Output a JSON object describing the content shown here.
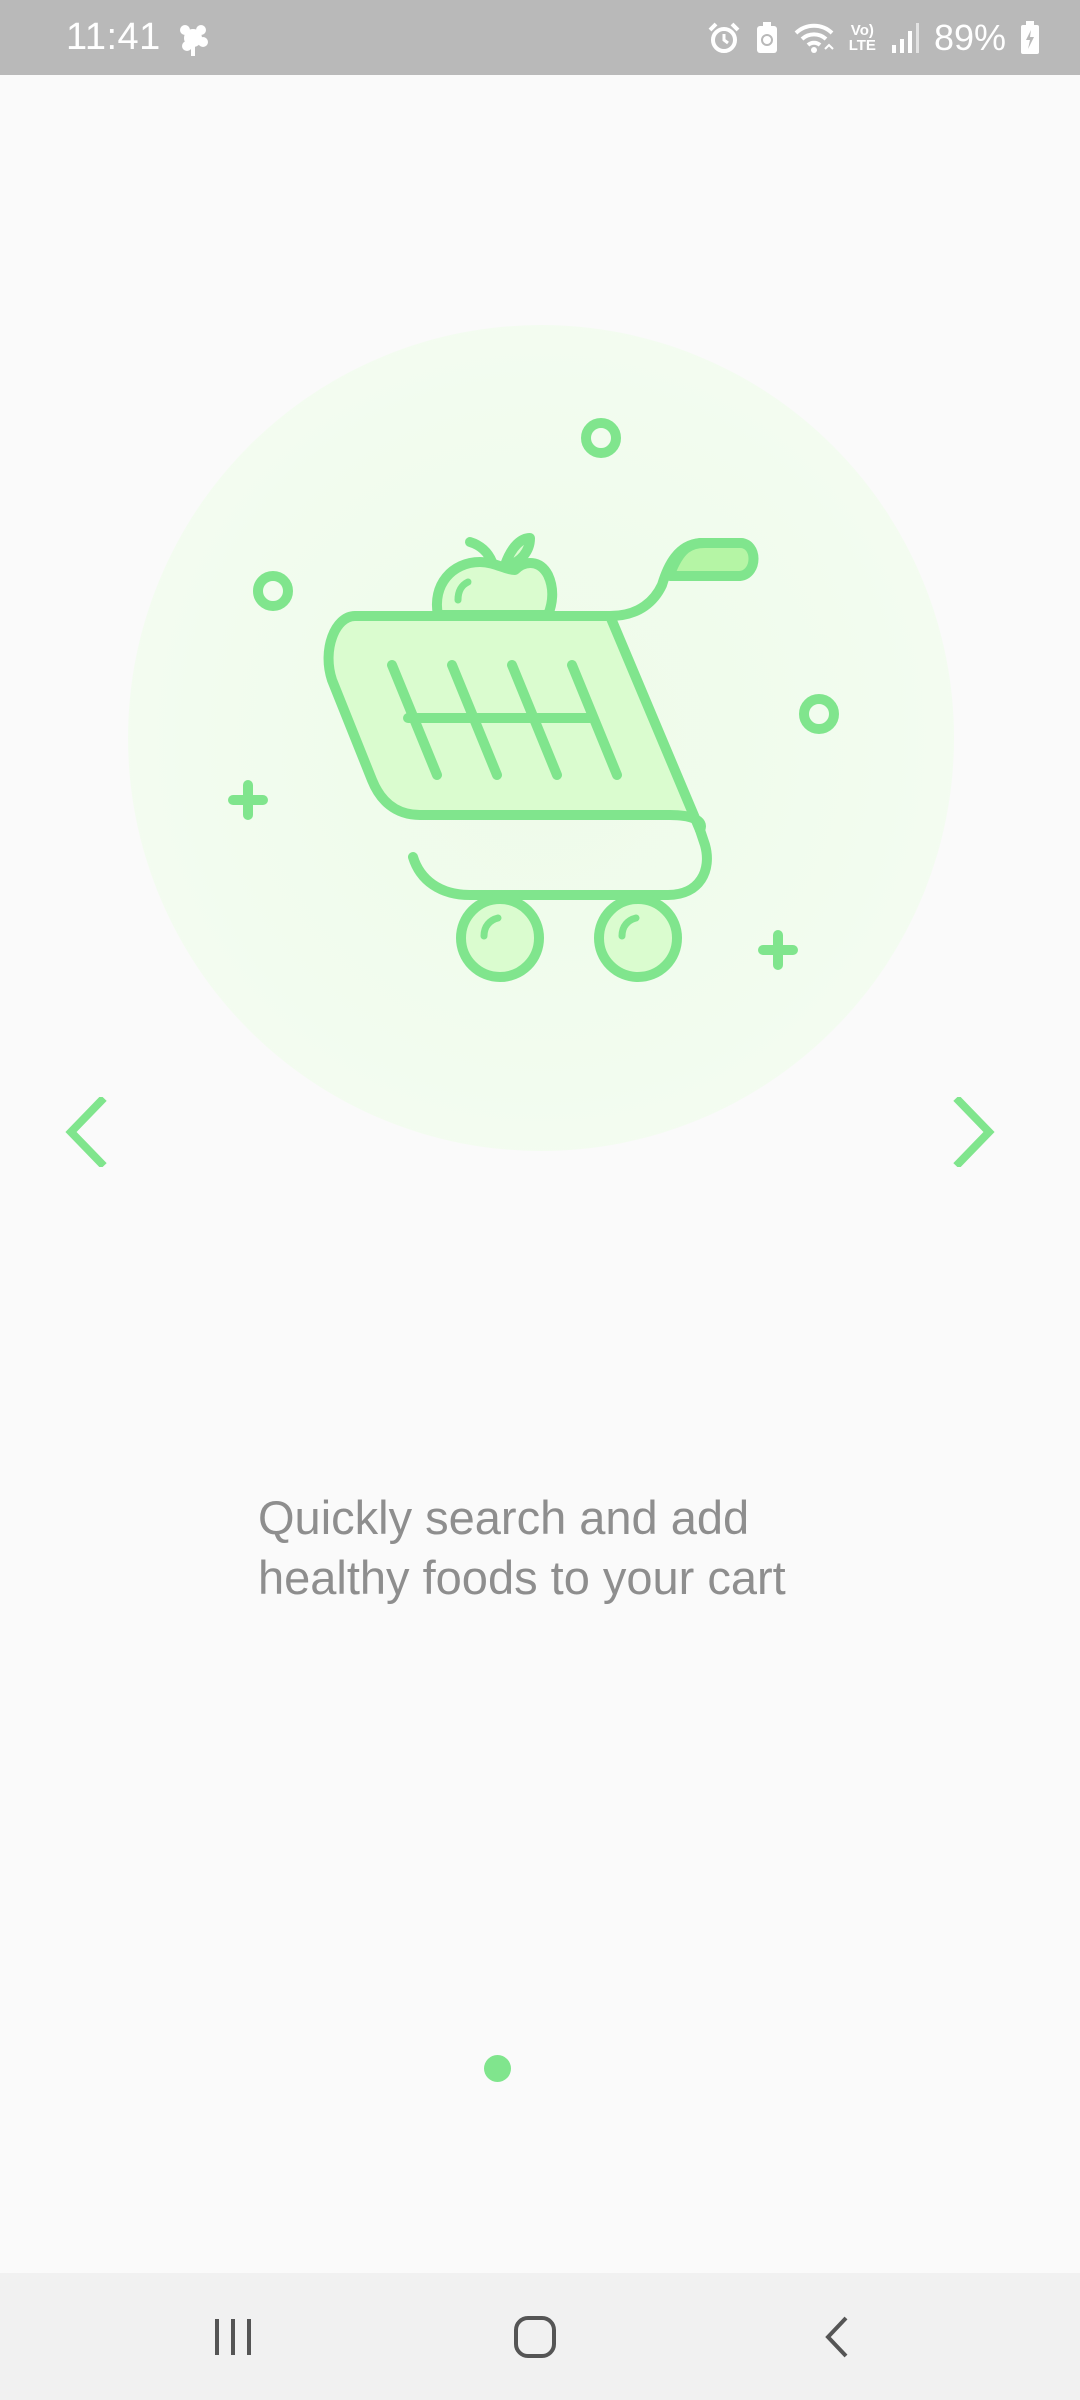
{
  "status_bar": {
    "time": "11:41",
    "notification_icon": "pinwheel-icon",
    "icons": [
      "alarm-icon",
      "battery-saver-icon",
      "wifi-icon",
      "volte-lte-icon",
      "signal-icon"
    ],
    "lte_label_top": "Vo)",
    "lte_label_bottom": "LTE",
    "battery_percent": "89%",
    "battery_icon": "battery-charging-icon"
  },
  "onboarding": {
    "illustration": "shopping-cart-with-apple",
    "caption_line1": "Quickly search and add",
    "caption_line2": "healthy foods to your cart",
    "prev_icon": "chevron-left-icon",
    "next_icon": "chevron-right-icon",
    "page_indicator": {
      "current": 1,
      "total": 1
    }
  },
  "nav_bar": {
    "recents_icon": "recents-icon",
    "home_icon": "home-icon",
    "back_icon": "back-icon"
  },
  "colors": {
    "accent": "#80e58d",
    "accent_fill": "#dafccf",
    "status_bar": "#b9b9b9",
    "background": "#fafafa",
    "caption": "#8e8e8e"
  }
}
